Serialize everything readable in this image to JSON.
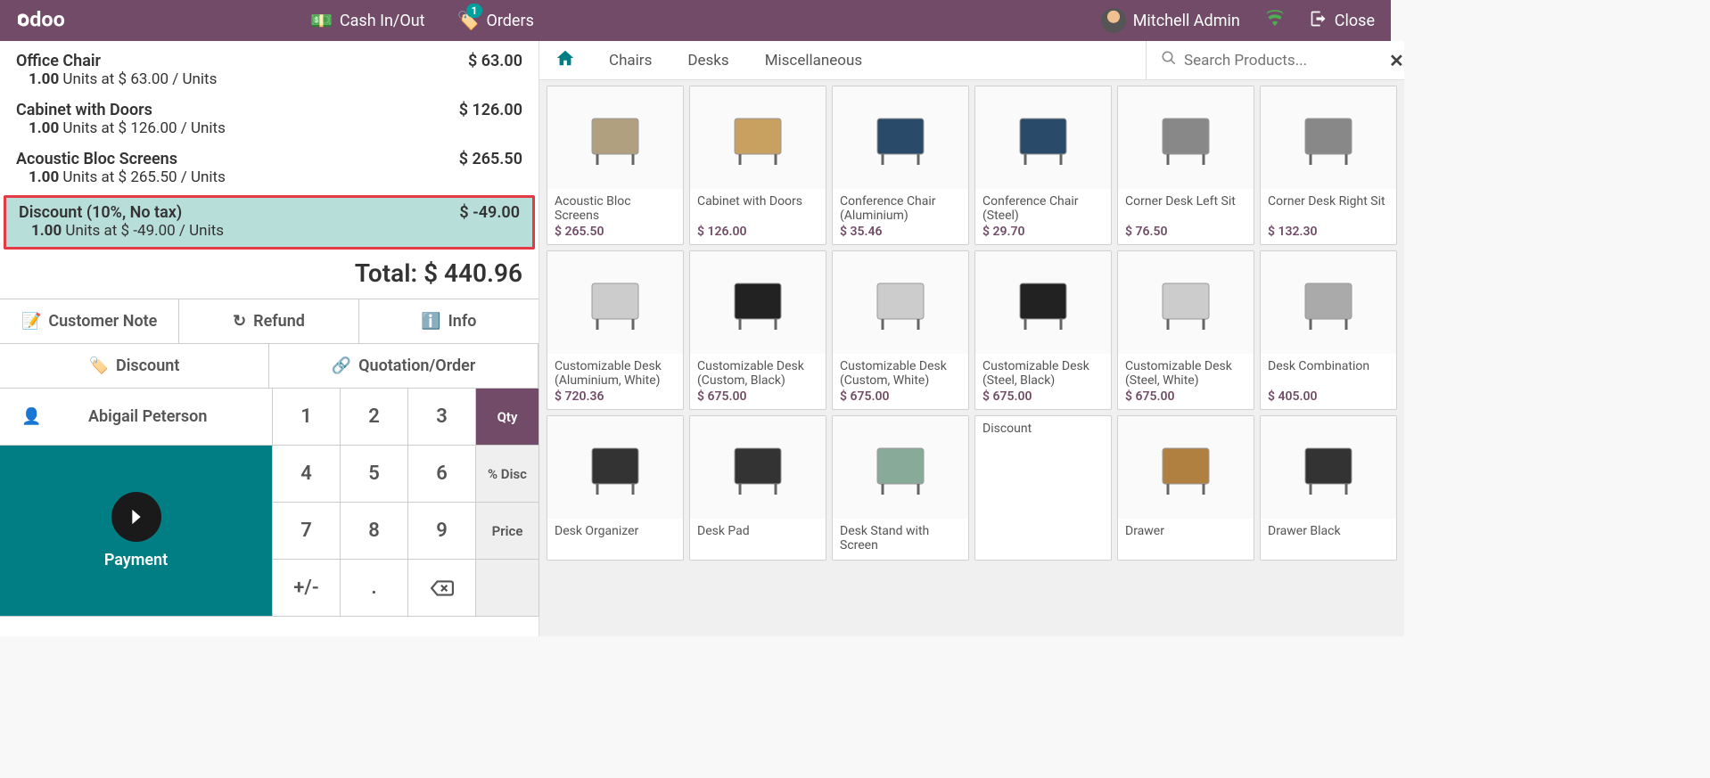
{
  "topbar": {
    "cash_label": "Cash In/Out",
    "orders_label": "Orders",
    "orders_count": "1",
    "user_name": "Mitchell Admin",
    "close_label": "Close"
  },
  "order": {
    "lines": [
      {
        "name": "Office Chair",
        "qty": "1.00",
        "unit_detail": "Units at $ 63.00 / Units",
        "price": "$ 63.00",
        "selected": false
      },
      {
        "name": "Cabinet with Doors",
        "qty": "1.00",
        "unit_detail": "Units at $ 126.00 / Units",
        "price": "$ 126.00",
        "selected": false
      },
      {
        "name": "Acoustic Bloc Screens",
        "qty": "1.00",
        "unit_detail": "Units at $ 265.50 / Units",
        "price": "$ 265.50",
        "selected": false
      },
      {
        "name": "Discount (10%, No tax)",
        "qty": "1.00",
        "unit_detail": "Units at $ -49.00 / Units",
        "price": "$ -49.00",
        "selected": true
      }
    ],
    "total_label": "Total:",
    "total_value": "$ 440.96"
  },
  "actions": {
    "customer_note": "Customer Note",
    "refund": "Refund",
    "info": "Info",
    "discount": "Discount",
    "quotation": "Quotation/Order"
  },
  "customer": "Abigail Peterson",
  "payment_label": "Payment",
  "numpad": {
    "keys": [
      [
        "1",
        "2",
        "3"
      ],
      [
        "4",
        "5",
        "6"
      ],
      [
        "7",
        "8",
        "9"
      ],
      [
        "+/-",
        ".",
        "⌫"
      ]
    ],
    "modes": [
      "Qty",
      "% Disc",
      "Price",
      ""
    ],
    "active_mode": 0
  },
  "categories": [
    "Chairs",
    "Desks",
    "Miscellaneous"
  ],
  "search_placeholder": "Search Products...",
  "products": [
    {
      "name": "Acoustic Bloc Screens",
      "price": "$ 265.50"
    },
    {
      "name": "Cabinet with Doors",
      "price": "$ 126.00"
    },
    {
      "name": "Conference Chair (Aluminium)",
      "price": "$ 35.46"
    },
    {
      "name": "Conference Chair (Steel)",
      "price": "$ 29.70"
    },
    {
      "name": "Corner Desk Left Sit",
      "price": "$ 76.50"
    },
    {
      "name": "Corner Desk Right Sit",
      "price": "$ 132.30"
    },
    {
      "name": "Customizable Desk (Aluminium, White)",
      "price": "$ 720.36"
    },
    {
      "name": "Customizable Desk (Custom, Black)",
      "price": "$ 675.00"
    },
    {
      "name": "Customizable Desk (Custom, White)",
      "price": "$ 675.00"
    },
    {
      "name": "Customizable Desk (Steel, Black)",
      "price": "$ 675.00"
    },
    {
      "name": "Customizable Desk (Steel, White)",
      "price": "$ 675.00"
    },
    {
      "name": "Desk Combination",
      "price": "$ 405.00"
    },
    {
      "name": "Desk Organizer",
      "price": ""
    },
    {
      "name": "Desk Pad",
      "price": ""
    },
    {
      "name": "Desk Stand with Screen",
      "price": ""
    },
    {
      "name": "Discount",
      "price": ""
    },
    {
      "name": "Drawer",
      "price": ""
    },
    {
      "name": "Drawer Black",
      "price": ""
    }
  ]
}
